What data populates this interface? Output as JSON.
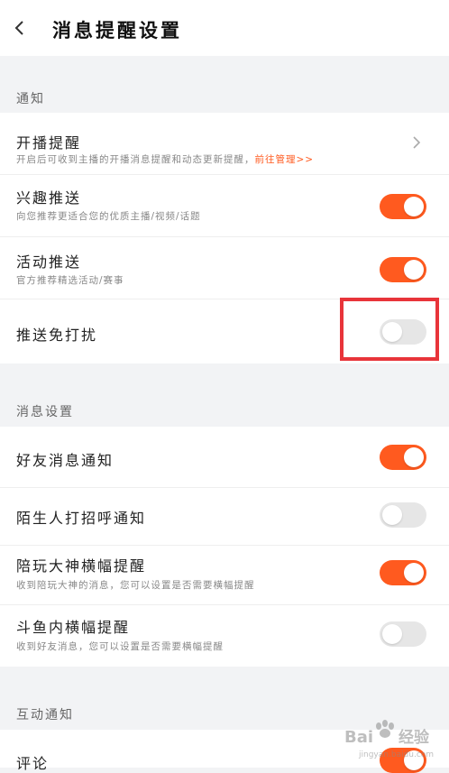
{
  "header": {
    "title": "消息提醒设置"
  },
  "sections": {
    "notify": {
      "label": "通知"
    },
    "message": {
      "label": "消息设置"
    },
    "interact": {
      "label": "互动通知"
    }
  },
  "rows": {
    "live_start": {
      "title": "开播提醒",
      "desc": "开启后可收到主播的开播消息提醒和动态更新提醒，",
      "link": "前往管理>>"
    },
    "interest_push": {
      "title": "兴趣推送",
      "desc": "向您推荐更适合您的优质主播/视频/话题",
      "enabled": true
    },
    "activity_push": {
      "title": "活动推送",
      "desc": "官方推荐精选活动/赛事",
      "enabled": true
    },
    "dnd_push": {
      "title": "推送免打扰",
      "enabled": false
    },
    "friend_msg": {
      "title": "好友消息通知",
      "enabled": true
    },
    "stranger_greet": {
      "title": "陌生人打招呼通知",
      "enabled": false
    },
    "companion_banner": {
      "title": "陪玩大神横幅提醒",
      "desc": "收到陪玩大神的消息，您可以设置是否需要横幅提醒",
      "enabled": true
    },
    "douyu_banner": {
      "title": "斗鱼内横幅提醒",
      "desc": "收到好友消息，您可以设置是否需要横幅提醒",
      "enabled": false
    },
    "comment": {
      "title": "评论",
      "enabled": true
    }
  },
  "watermark": {
    "text": "Bai经验",
    "sub": "jingyan.baidu.com"
  },
  "colors": {
    "accent": "#ff5a1f",
    "toggle_off": "#e6e6e6",
    "highlight": "#e8343a"
  }
}
